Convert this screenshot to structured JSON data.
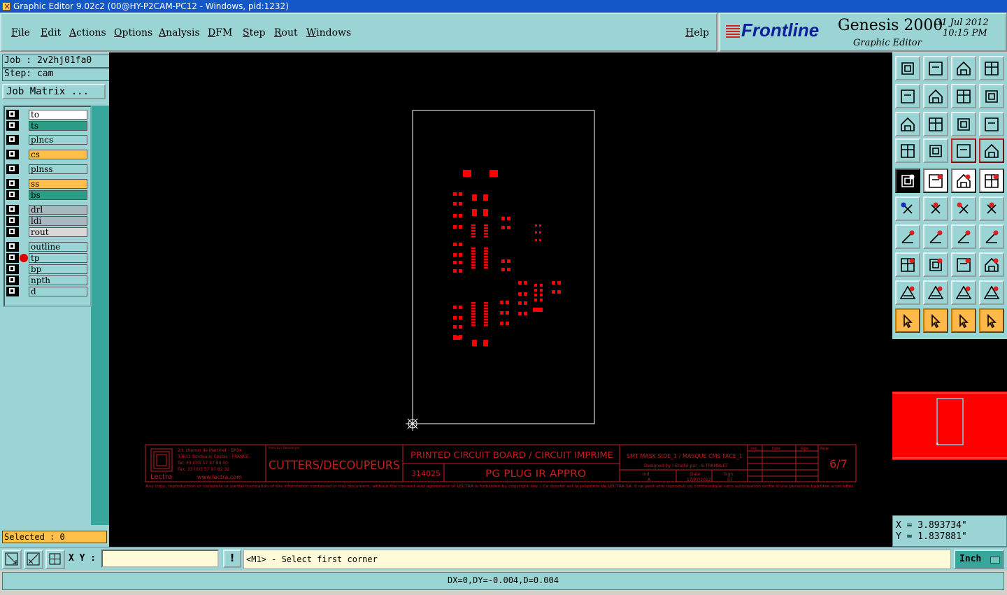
{
  "window": {
    "title": "Graphic Editor 9.02c2 (00@HY-P2CAM-PC12 - Windows, pid:1232)"
  },
  "menu": [
    "File",
    "Edit",
    "Actions",
    "Options",
    "Analysis",
    "DFM",
    "Step",
    "Rout",
    "Windows"
  ],
  "help_label": "Help",
  "brand": {
    "logo": "Frontline",
    "product": "Genesis 2000",
    "subtitle": "Graphic Editor",
    "date": "31 Jul 2012",
    "time": "10:15 PM"
  },
  "job": {
    "job_label": "Job : 2v2hj01fa0",
    "step_label": "Step: cam",
    "matrix_button": "Job Matrix ..."
  },
  "layers": [
    {
      "name": "to",
      "color": "#ffffff"
    },
    {
      "name": "ts",
      "color": "#2a9d86"
    },
    {
      "name": "plncs",
      "color": "#9ad4d4"
    },
    {
      "name": "cs",
      "color": "#ffc04a"
    },
    {
      "name": "plnss",
      "color": "#9ad4d4"
    },
    {
      "name": "ss",
      "color": "#ffc04a"
    },
    {
      "name": "bs",
      "color": "#2a9d86"
    },
    {
      "name": "drl",
      "color": "#a8b8c0"
    },
    {
      "name": "ldi",
      "color": "#a8b8c0"
    },
    {
      "name": "rout",
      "color": "#d8d8d8"
    },
    {
      "name": "outline",
      "color": "#9ad4d4"
    },
    {
      "name": "tp",
      "color": "#9ad4d4"
    },
    {
      "name": "bp",
      "color": "#9ad4d4"
    },
    {
      "name": "npth",
      "color": "#9ad4d4"
    },
    {
      "name": "d",
      "color": "#9ad4d4"
    }
  ],
  "selected_label": "Selected : 0",
  "titleblock": {
    "address_lines": [
      "23, chemin de Martinet - BP34",
      "33611 Bordeaux Cestas - FRANCE",
      "Tel: 33 (0)5 57 97 80 00",
      "Fax: 33 (0)5 57 97 82 32"
    ],
    "company": "Lectra",
    "website": "www.lectra.com",
    "drawn_by_label": "Plans by / Dessiné par",
    "main_text": "CUTTERS/DECOUPEURS",
    "title": "PRINTED CIRCUIT BOARD / CIRCUIT IMPRIME",
    "part_number": "314025",
    "part_name": "PG PLUG IR APPRO",
    "subtitle": "SMT MASK SIDE_1 / MASQUE CMS FACE_1",
    "designer": "Designed by / Etudié par : S.TRAMBLET",
    "col_ind": "Ind.",
    "col_date": "Date",
    "col_sign": "Sign.",
    "col_page": "Page",
    "row_ind": "A",
    "row_date": "17/07/2012",
    "row_sign": "ST",
    "page": "6/7",
    "copyright": "Any copy, reproduction or complete or partial translation of the information contained in this document, without the consent and agreement of LECTRA is forbidden by copyright law. / Ce dossier est la propriete de LECTRA SA. Il ne peut etre reproduit ou communique sans autorisation ecrite d'une personne habilitee a cet effet."
  },
  "coords": {
    "x": "X = 3.893734\"",
    "y": "Y = 1.837881\""
  },
  "bottom": {
    "xy_label": "X Y :",
    "xy_value": "",
    "prompt": "<M1> - Select first corner",
    "units": "Inch"
  },
  "status": "DX=0,DY=-0.004,D=0.004",
  "colors": {
    "accent": "#9ad4d4",
    "canvas": "#000000",
    "features": "#ff0000",
    "titleblock": "#c02020"
  },
  "icons": [
    "home-icon",
    "zoom-in-icon",
    "zoom-out-icon",
    "fit-icon",
    "pan-icon",
    "snap-icon",
    "ratio-icon",
    "help-icon",
    "measure-icon",
    "grid-icon",
    "route-icon",
    "select-icon"
  ]
}
